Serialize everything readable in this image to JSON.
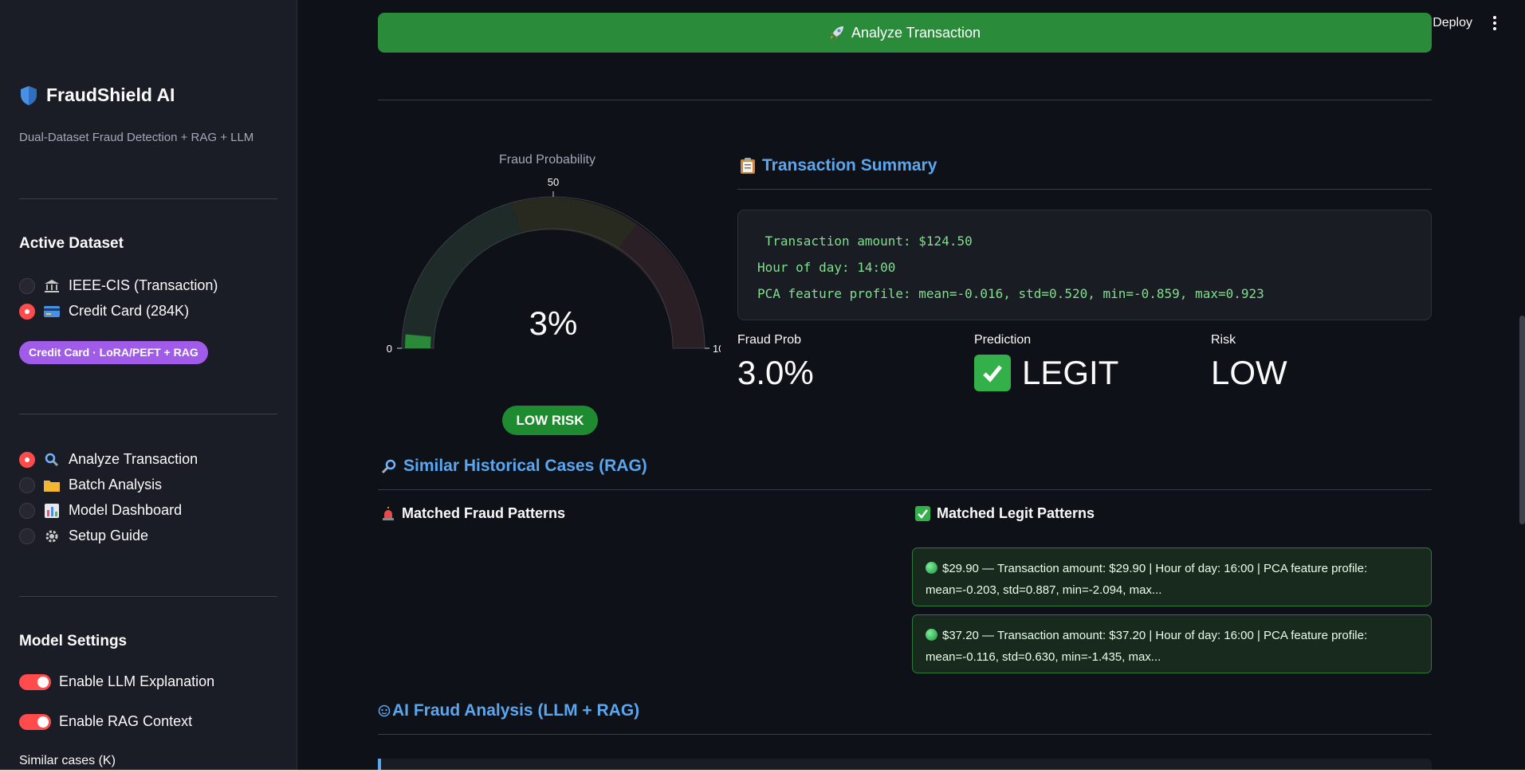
{
  "sidebar": {
    "brand_title": "FraudShield AI",
    "brand_subtitle": "Dual-Dataset Fraud Detection + RAG + LLM",
    "dataset_heading": "Active Dataset",
    "datasets": [
      {
        "label": "IEEE-CIS (Transaction)",
        "icon": "bank-icon",
        "selected": false
      },
      {
        "label": "Credit Card (284K)",
        "icon": "credit-card-icon",
        "selected": true
      }
    ],
    "dataset_badge": "Credit Card · LoRA/PEFT + RAG",
    "nav": [
      {
        "label": "Analyze Transaction",
        "icon": "magnifier-icon",
        "selected": true
      },
      {
        "label": "Batch Analysis",
        "icon": "folder-icon",
        "selected": false
      },
      {
        "label": "Model Dashboard",
        "icon": "bar-chart-icon",
        "selected": false
      },
      {
        "label": "Setup Guide",
        "icon": "gear-icon",
        "selected": false
      }
    ],
    "settings_heading": "Model Settings",
    "toggles": [
      {
        "label": "Enable LLM Explanation",
        "on": true
      },
      {
        "label": "Enable RAG Context",
        "on": true
      }
    ],
    "similar_cases_label": "Similar cases (K)"
  },
  "header": {
    "deploy_label": "Deploy"
  },
  "main": {
    "analyze_button": "Analyze Transaction",
    "gauge": {
      "title": "Fraud Probability",
      "value_label": "3%",
      "value": 3,
      "min_label": "0",
      "mid_label": "50",
      "max_label": "10",
      "risk_badge": "LOW RISK"
    },
    "summary_title": "Transaction Summary",
    "summary_lines": [
      " Transaction amount: $124.50",
      "Hour of day: 14:00",
      "PCA feature profile: mean=-0.016, std=0.520, min=-0.859, max=0.923"
    ],
    "metrics": {
      "fraud_prob_label": "Fraud Prob",
      "fraud_prob_value": "3.0%",
      "prediction_label": "Prediction",
      "prediction_value": "LEGIT",
      "risk_label": "Risk",
      "risk_value": "LOW"
    },
    "rag_title": "Similar Historical Cases (RAG)",
    "fraud_patterns_title": "Matched Fraud Patterns",
    "legit_patterns_title": "Matched Legit Patterns",
    "legit_cases": [
      {
        "line1": "$29.90 — Transaction amount: $29.90 | Hour of day: 16:00 | PCA feature profile:",
        "line2": "mean=-0.203, std=0.887, min=-2.094, max..."
      },
      {
        "line1": "$37.20 — Transaction amount: $37.20 | Hour of day: 16:00 | PCA feature profile:",
        "line2": "mean=-0.116, std=0.630, min=-1.435, max..."
      }
    ],
    "llm_title": "AI Fraud Analysis (LLM + RAG)"
  },
  "colors": {
    "accent": "#ff4b4b",
    "success": "#2a8b3a",
    "heading_blue": "#5aa7f0",
    "badge_purple": "#a05ce8"
  }
}
